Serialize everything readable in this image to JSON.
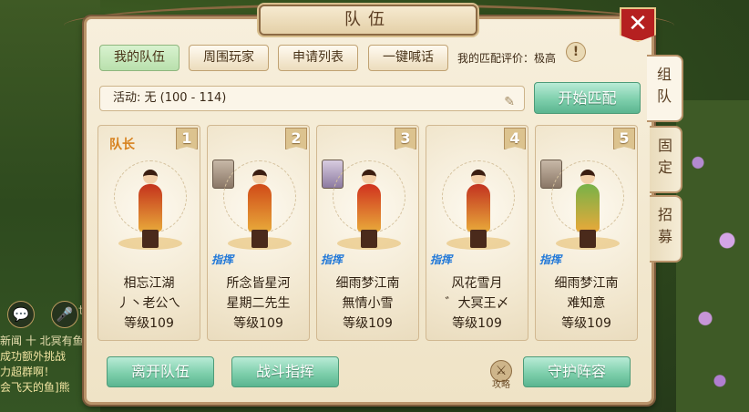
{
  "window": {
    "title": "队伍",
    "close": "✕"
  },
  "top_tabs": [
    {
      "label": "我的队伍",
      "active": true
    },
    {
      "label": "周围玩家",
      "active": false
    },
    {
      "label": "申请列表",
      "active": false
    },
    {
      "label": "一键喊话",
      "active": false
    }
  ],
  "rating": "我的匹配评价：极高",
  "help_icon": "!",
  "activity": {
    "value": "活动: 无 (100 - 114)",
    "edit_icon": "✎"
  },
  "start_match": "开始匹配",
  "side_tabs": [
    {
      "label": "组队",
      "active": true
    },
    {
      "label": "固定",
      "active": false
    },
    {
      "label": "招募",
      "active": false
    }
  ],
  "members": [
    {
      "slot": "1",
      "badge": "队长",
      "command": "",
      "line1": "相忘江湖",
      "line2": "丿丶老公ㄟ",
      "level": "等级109",
      "color": "#c4321c"
    },
    {
      "slot": "2",
      "badge": "",
      "command": "指挥",
      "line1": "所念皆星河",
      "line2": "星期二先生",
      "level": "等级109",
      "color": "#d04a18"
    },
    {
      "slot": "3",
      "badge": "",
      "command": "指挥",
      "line1": "细雨梦江南",
      "line2": "無情小雪",
      "level": "等级109",
      "color": "#d0321e"
    },
    {
      "slot": "4",
      "badge": "",
      "command": "指挥",
      "line1": "风花雪月",
      "line2": "゛大冥王〆",
      "level": "等级109",
      "color": "#c23220"
    },
    {
      "slot": "5",
      "badge": "",
      "command": "指挥",
      "line1": "细雨梦江南",
      "line2": "难知意",
      "level": "等级109",
      "color": "#78b248"
    }
  ],
  "bottom": {
    "leave": "离开队伍",
    "command": "战斗指挥",
    "guide": "攻略",
    "guard": "守护阵容"
  },
  "hud": {
    "chat_icon": "💬",
    "mic_icon": "🎤",
    "world_label": "世",
    "news_label": "闻",
    "chat_lines": [
      "新闻 十  北冥有鱼",
      "成功额外挑战",
      "力超群啊！",
      "会飞天的鱼]熊"
    ]
  }
}
